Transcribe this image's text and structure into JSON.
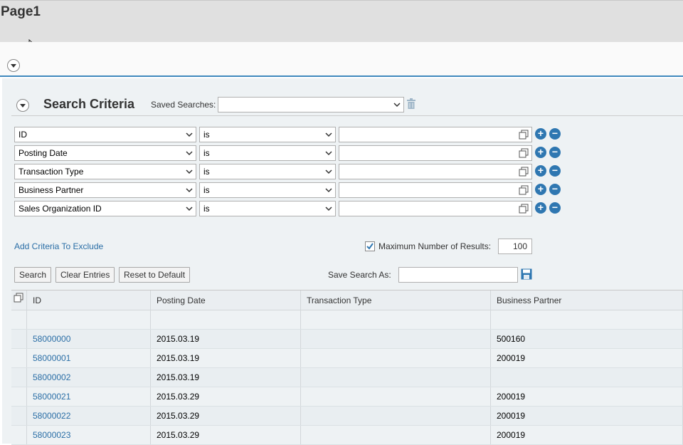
{
  "page": {
    "title": "Page1"
  },
  "search": {
    "title": "Search Criteria",
    "saved_searches_label": "Saved Searches:",
    "saved_searches_value": "",
    "criteria": [
      {
        "field": "ID",
        "operator": "is",
        "value": ""
      },
      {
        "field": "Posting Date",
        "operator": "is",
        "value": ""
      },
      {
        "field": "Transaction Type",
        "operator": "is",
        "value": ""
      },
      {
        "field": "Business Partner",
        "operator": "is",
        "value": ""
      },
      {
        "field": "Sales Organization ID",
        "operator": "is",
        "value": ""
      }
    ],
    "add_exclude_link": "Add Criteria To Exclude",
    "max_results_label": "Maximum Number of Results:",
    "max_results_value": "100",
    "max_results_checked": true,
    "buttons": {
      "search": "Search",
      "clear": "Clear Entries",
      "reset": "Reset to Default"
    },
    "save_as_label": "Save Search As:",
    "save_as_value": ""
  },
  "results": {
    "columns": [
      "ID",
      "Posting Date",
      "Transaction Type",
      "Business Partner"
    ],
    "rows": [
      {
        "id": "",
        "posting_date": "",
        "transaction_type": "",
        "business_partner": ""
      },
      {
        "id": "58000000",
        "posting_date": "2015.03.19",
        "transaction_type": "",
        "business_partner": "500160"
      },
      {
        "id": "58000001",
        "posting_date": "2015.03.19",
        "transaction_type": "",
        "business_partner": "200019"
      },
      {
        "id": "58000002",
        "posting_date": "2015.03.19",
        "transaction_type": "",
        "business_partner": ""
      },
      {
        "id": "58000021",
        "posting_date": "2015.03.29",
        "transaction_type": "",
        "business_partner": "200019"
      },
      {
        "id": "58000022",
        "posting_date": "2015.03.29",
        "transaction_type": "",
        "business_partner": "200019"
      },
      {
        "id": "58000023",
        "posting_date": "2015.03.29",
        "transaction_type": "",
        "business_partner": "200019"
      }
    ]
  },
  "colors": {
    "accent": "#3f88bd",
    "link": "#2a6ea6",
    "icon_blue": "#2f77b1"
  }
}
